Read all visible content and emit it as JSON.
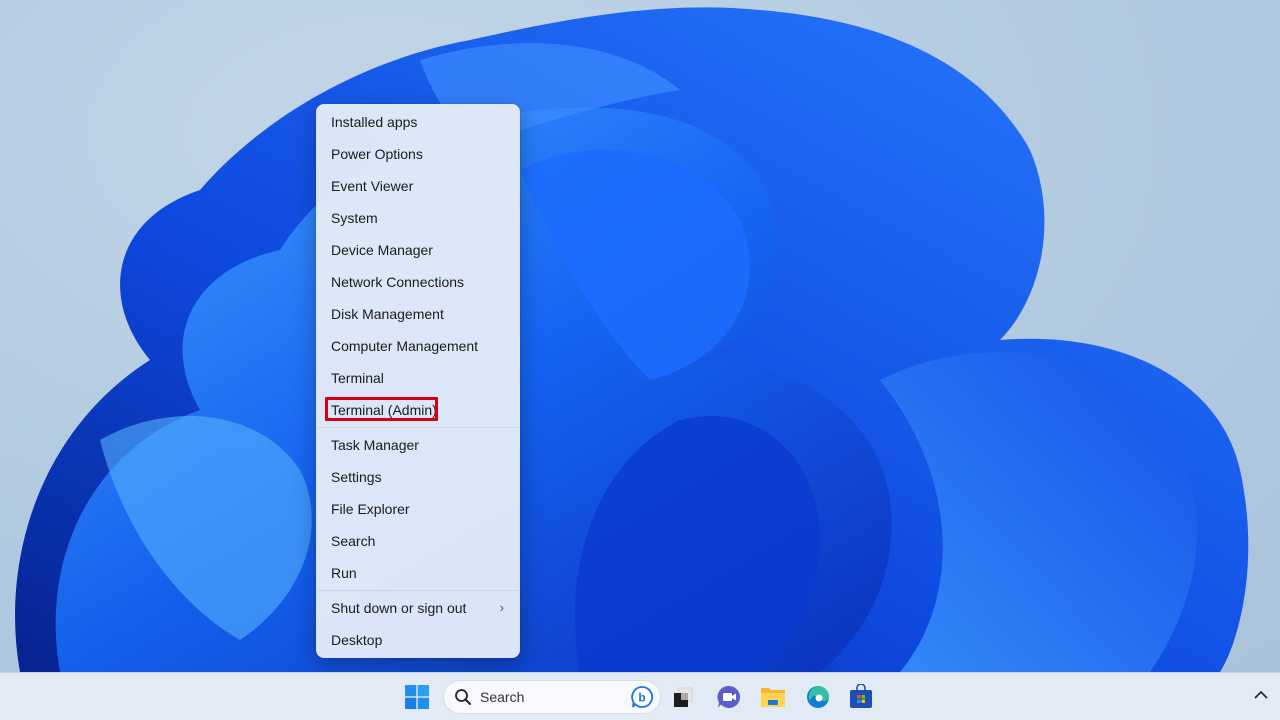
{
  "context_menu": {
    "items": [
      {
        "label": "Installed apps"
      },
      {
        "label": "Power Options"
      },
      {
        "label": "Event Viewer"
      },
      {
        "label": "System"
      },
      {
        "label": "Device Manager"
      },
      {
        "label": "Network Connections"
      },
      {
        "label": "Disk Management"
      },
      {
        "label": "Computer Management"
      },
      {
        "label": "Terminal"
      },
      {
        "label": "Terminal (Admin)",
        "highlighted": true
      },
      {
        "label": "Task Manager"
      },
      {
        "label": "Settings"
      },
      {
        "label": "File Explorer"
      },
      {
        "label": "Search"
      },
      {
        "label": "Run"
      },
      {
        "label": "Shut down or sign out",
        "submenu": true,
        "chevron": "›"
      },
      {
        "label": "Desktop"
      }
    ],
    "highlight_color": "#d40012"
  },
  "taskbar": {
    "search_label": "Search",
    "icons": [
      "windows-start-icon",
      "search-icon",
      "bing-icon",
      "task-view-icon",
      "teams-chat-icon",
      "file-explorer-icon",
      "edge-browser-icon",
      "microsoft-store-icon"
    ],
    "tray_chevron": "^"
  },
  "colors": {
    "wallpaper_blue": "#1a5cf0",
    "menu_bg": "#e2eaf8",
    "taskbar_bg": "#e2eaf6"
  }
}
